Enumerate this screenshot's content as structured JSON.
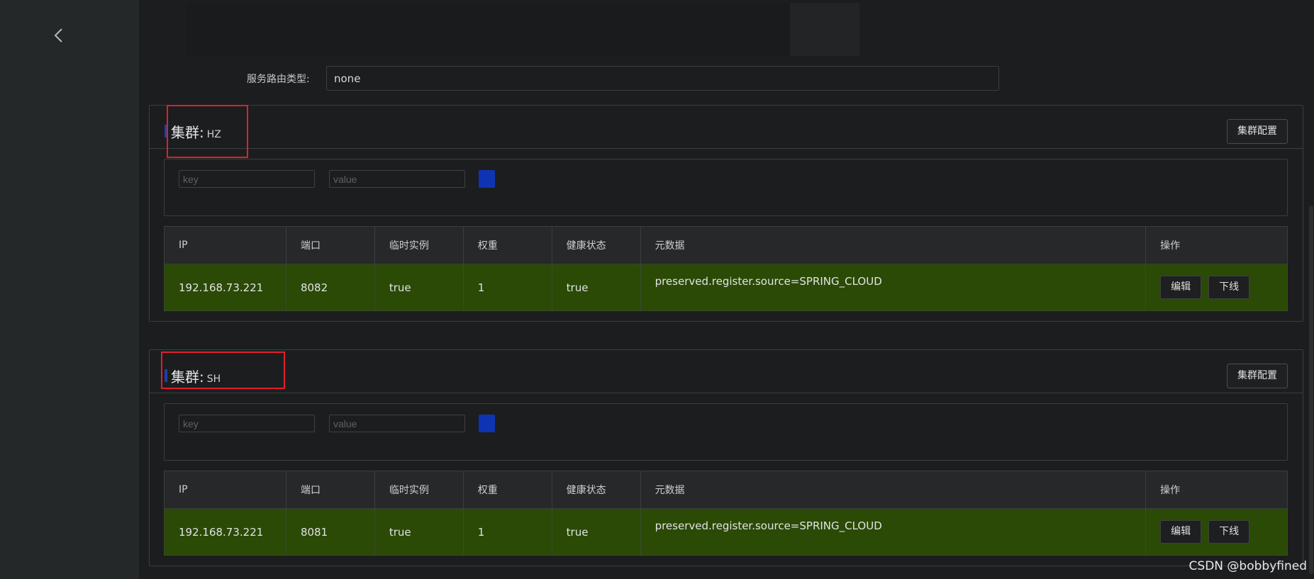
{
  "route": {
    "label": "服务路由类型:",
    "value": "none"
  },
  "clusters": [
    {
      "title": "集群:",
      "name": "HZ",
      "config_button": "集群配置",
      "filter": {
        "key_placeholder": "key",
        "value_placeholder": "value"
      },
      "table": {
        "headers": [
          "IP",
          "端口",
          "临时实例",
          "权重",
          "健康状态",
          "元数据",
          "操作"
        ],
        "rows": [
          {
            "ip": "192.168.73.221",
            "port": "8082",
            "ephemeral": "true",
            "weight": "1",
            "healthy": "true",
            "metadata": "preserved.register.source=SPRING_CLOUD",
            "edit": "编辑",
            "offline": "下线"
          }
        ]
      }
    },
    {
      "title": "集群:",
      "name": "SH",
      "config_button": "集群配置",
      "filter": {
        "key_placeholder": "key",
        "value_placeholder": "value"
      },
      "table": {
        "headers": [
          "IP",
          "端口",
          "临时实例",
          "权重",
          "健康状态",
          "元数据",
          "操作"
        ],
        "rows": [
          {
            "ip": "192.168.73.221",
            "port": "8081",
            "ephemeral": "true",
            "weight": "1",
            "healthy": "true",
            "metadata": "preserved.register.source=SPRING_CLOUD",
            "edit": "编辑",
            "offline": "下线"
          }
        ]
      }
    }
  ],
  "watermark": "CSDN @bobbyfined",
  "colors": {
    "row_background": "#2a4a06",
    "accent_blue": "#0e34b3",
    "highlight_red": "#e0202a"
  },
  "icons": {
    "back": "chevron-left-icon"
  }
}
